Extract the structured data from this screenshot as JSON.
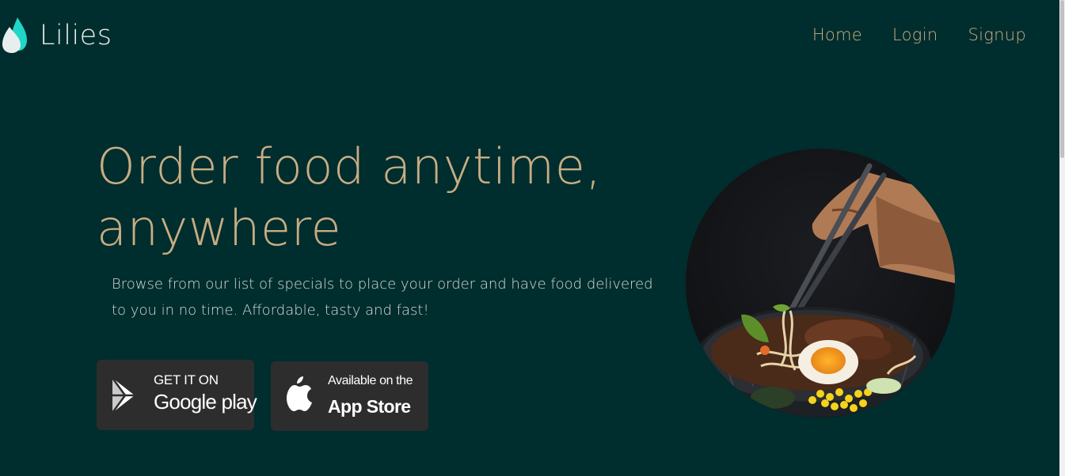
{
  "brand": {
    "name": "Lilies",
    "logo_icon": "leaf-drops-icon",
    "logo_colors": [
      "#1fd6c8",
      "#e8eeee"
    ]
  },
  "nav": {
    "items": [
      {
        "label": "Home"
      },
      {
        "label": "Login"
      },
      {
        "label": "Signup"
      }
    ]
  },
  "hero": {
    "title_line1": "Order food anytime,",
    "title_line2": "anywhere",
    "description": "Browse from our list of specials to place your order and have food delivered to you in no time. Affordable, tasty and fast!",
    "image_icon": "ramen-bowl-chopsticks-image"
  },
  "stores": {
    "google": {
      "small": "GET IT ON",
      "big": "Google play",
      "icon": "google-play-icon"
    },
    "apple": {
      "small": "Available on the",
      "big": "App Store",
      "icon": "apple-icon"
    }
  },
  "colors": {
    "background": "#002d2d",
    "accent_gold": "#c8ad84",
    "button_bg": "#2d2d2d",
    "text_light": "#d3dddc"
  }
}
